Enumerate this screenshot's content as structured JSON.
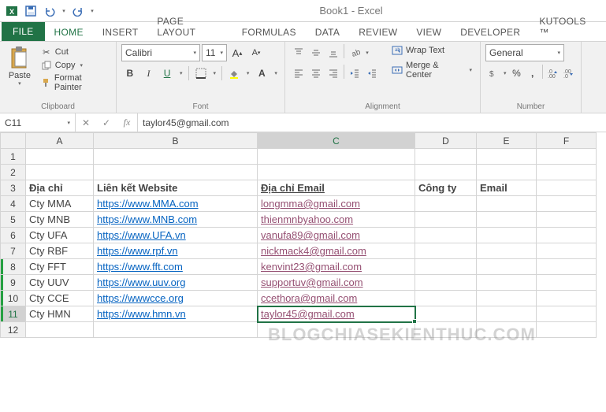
{
  "title": "Book1 - Excel",
  "qat": {
    "save": "save-icon",
    "undo": "undo-icon",
    "redo": "redo-icon"
  },
  "tabs": [
    "FILE",
    "HOME",
    "INSERT",
    "PAGE LAYOUT",
    "FORMULAS",
    "DATA",
    "REVIEW",
    "VIEW",
    "DEVELOPER",
    "KUTOOLS ™"
  ],
  "active_tab": 1,
  "ribbon": {
    "clipboard": {
      "label": "Clipboard",
      "paste": "Paste",
      "cut": "Cut",
      "copy": "Copy",
      "format_painter": "Format Painter"
    },
    "font": {
      "label": "Font",
      "name": "Calibri",
      "size": "11",
      "grow": "A",
      "shrink": "A",
      "bold": "B",
      "italic": "I",
      "underline": "U"
    },
    "alignment": {
      "label": "Alignment",
      "wrap": "Wrap Text",
      "merge": "Merge & Center"
    },
    "number": {
      "label": "Number",
      "format": "General"
    }
  },
  "namebox": "C11",
  "formula": "taylor45@gmail.com",
  "columns": [
    "A",
    "B",
    "C",
    "D",
    "E",
    "F"
  ],
  "selected_col": "C",
  "selected_row": 11,
  "green_rows": [
    8,
    9,
    10,
    11
  ],
  "rows": [
    {
      "n": 1,
      "c": {}
    },
    {
      "n": 2,
      "c": {}
    },
    {
      "n": 3,
      "c": {
        "A": {
          "t": "Địa chỉ",
          "b": 1
        },
        "B": {
          "t": "Liên kết Website",
          "b": 1,
          "ctr": 1
        },
        "C": {
          "t": "Địa chỉ Email",
          "b": 1,
          "u": 1
        },
        "D": {
          "t": "Công ty",
          "b": 1
        },
        "E": {
          "t": "Email",
          "b": 1
        }
      }
    },
    {
      "n": 4,
      "c": {
        "A": {
          "t": "Cty MMA"
        },
        "B": {
          "t": "https://www.MMA.com",
          "lk": "b"
        },
        "C": {
          "t": "longmma@gmail.com",
          "lk": "p"
        }
      }
    },
    {
      "n": 5,
      "c": {
        "A": {
          "t": "Cty MNB"
        },
        "B": {
          "t": "https://www.MNB.com",
          "lk": "b"
        },
        "C": {
          "t": "thienmnbyahoo.com",
          "lk": "p"
        }
      }
    },
    {
      "n": 6,
      "c": {
        "A": {
          "t": "Cty UFA"
        },
        "B": {
          "t": "https://www.UFA.vn",
          "lk": "b"
        },
        "C": {
          "t": "vanufa89@gmail.com",
          "lk": "p"
        }
      }
    },
    {
      "n": 7,
      "c": {
        "A": {
          "t": "Cty RBF"
        },
        "B": {
          "t": "https://www.rpf.vn",
          "lk": "b"
        },
        "C": {
          "t": "nickmack4@gmail.com",
          "lk": "p"
        }
      }
    },
    {
      "n": 8,
      "c": {
        "A": {
          "t": "Cty FFT"
        },
        "B": {
          "t": "https://www.fft.com",
          "lk": "b"
        },
        "C": {
          "t": "kenvint23@gmail.com",
          "lk": "p"
        }
      }
    },
    {
      "n": 9,
      "c": {
        "A": {
          "t": "Cty UUV"
        },
        "B": {
          "t": "https://www.uuv.org",
          "lk": "b"
        },
        "C": {
          "t": "supportuv@gmail.com",
          "lk": "p"
        }
      }
    },
    {
      "n": 10,
      "c": {
        "A": {
          "t": "Cty CCE"
        },
        "B": {
          "t": "https://wwwcce.org",
          "lk": "b"
        },
        "C": {
          "t": "ccethora@gmail.com",
          "lk": "p"
        }
      }
    },
    {
      "n": 11,
      "c": {
        "A": {
          "t": "Cty HMN"
        },
        "B": {
          "t": "https://www.hmn.vn",
          "lk": "b"
        },
        "C": {
          "t": "taylor45@gmail.com",
          "lk": "p"
        }
      }
    },
    {
      "n": 12,
      "c": {}
    }
  ],
  "watermark": "BLOGCHIASEKIENTHUC.COM"
}
